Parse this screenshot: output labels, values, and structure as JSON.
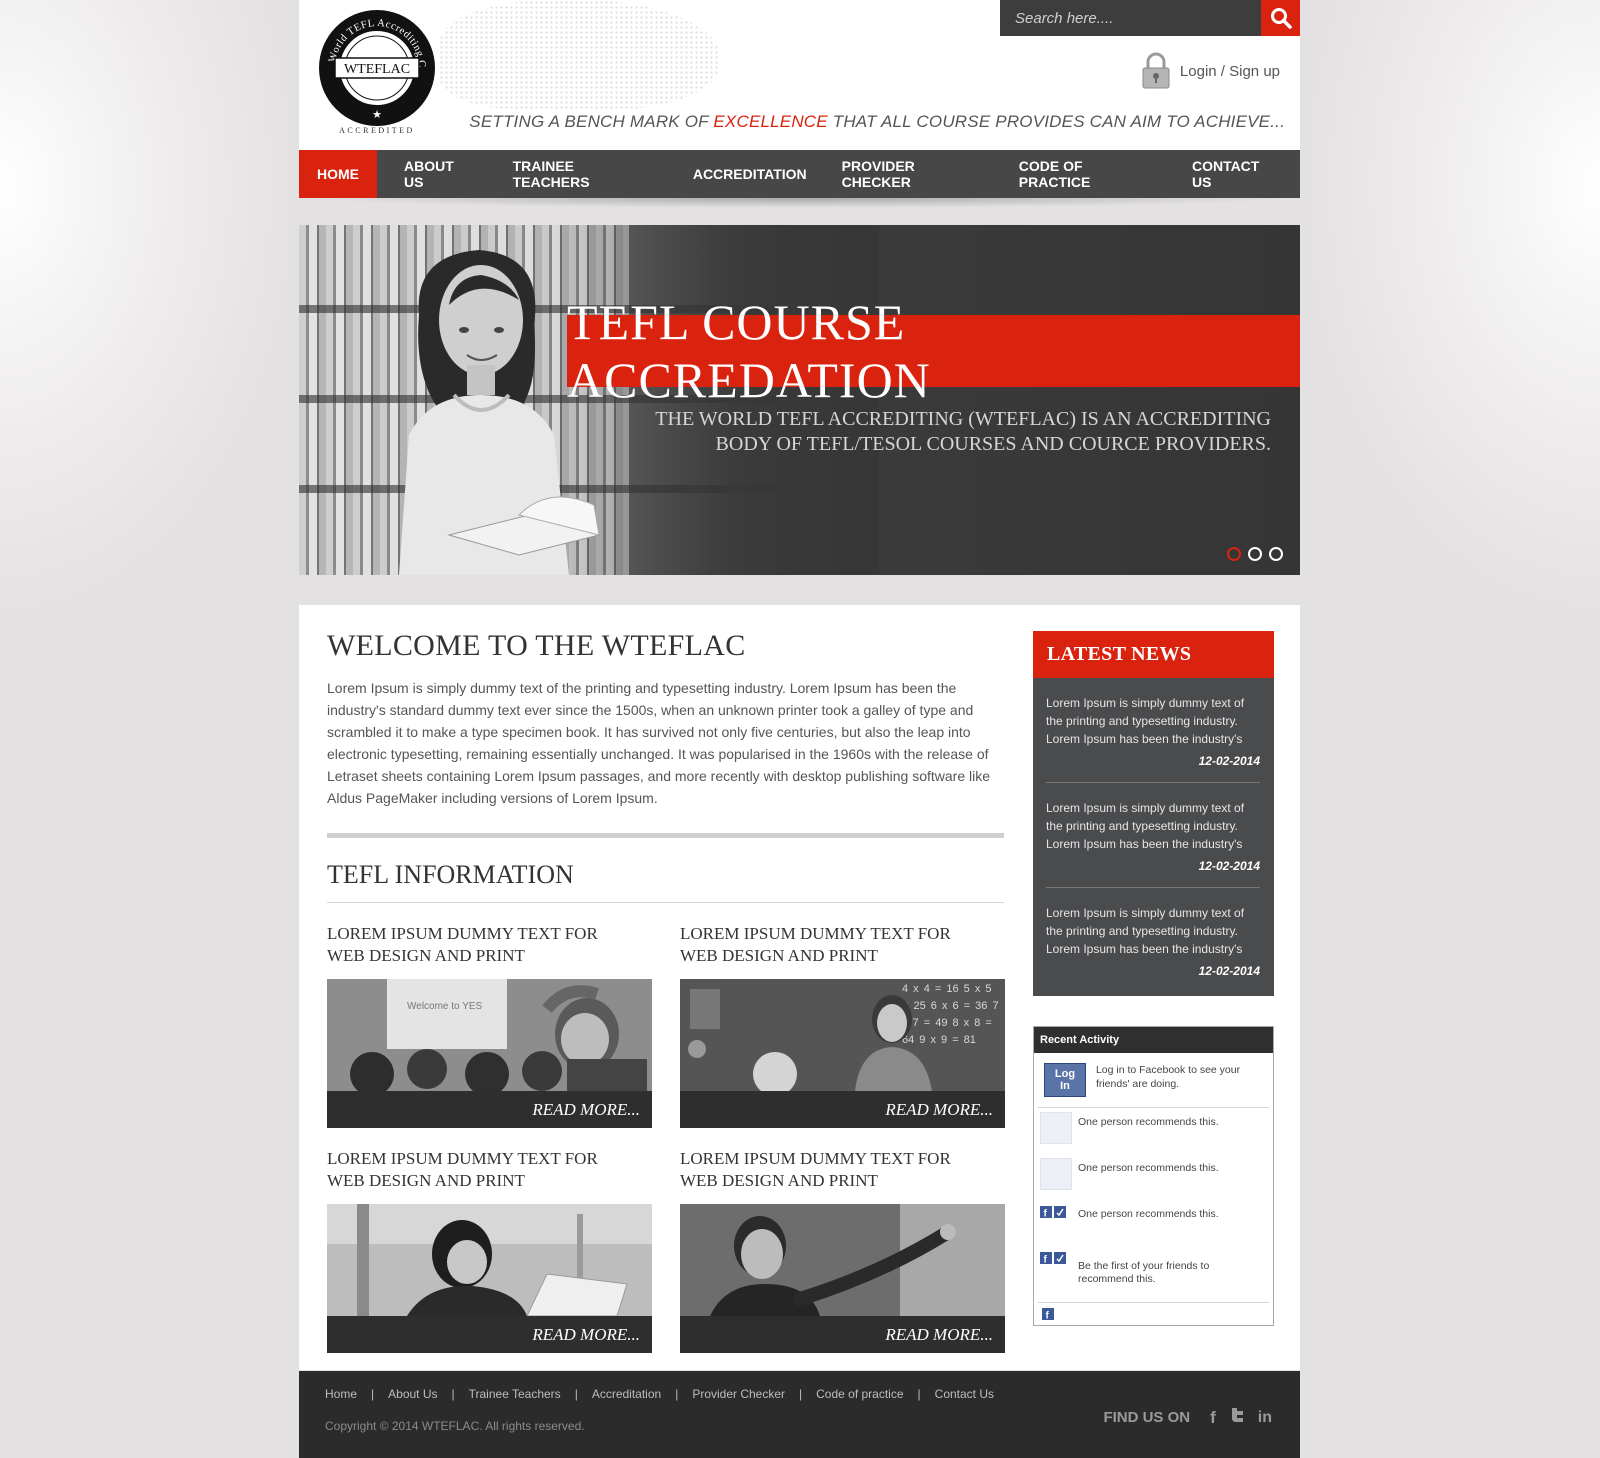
{
  "header": {
    "logo_ring_text": "World TEFL Accrediting Commission",
    "logo_name": "WTEFLAC",
    "logo_sub": "ACCREDITED",
    "search_placeholder": "Search here....",
    "login_label": "Login / Sign up",
    "tagline_pre": "SETTING A BENCH MARK OF ",
    "tagline_highlight": "EXCELLENCE",
    "tagline_post": " THAT ALL COURSE PROVIDES CAN AIM TO ACHIEVE..."
  },
  "nav": {
    "items": [
      {
        "label": "HOME",
        "active": true
      },
      {
        "label": "ABOUT US"
      },
      {
        "label": "TRAINEE TEACHERS"
      },
      {
        "label": "ACCREDITATION"
      },
      {
        "label": "PROVIDER CHECKER"
      },
      {
        "label": "CODE OF PRACTICE"
      },
      {
        "label": "CONTACT US"
      }
    ]
  },
  "hero": {
    "title": "TEFL COURSE ACCREDATION",
    "subtitle_line1": "THE WORLD TEFL ACCREDITING (WTEFLAC) IS AN ACCREDITING",
    "subtitle_line2": "BODY OF TEFL/TESOL COURSES AND COURCE PROVIDERS.",
    "slides": 3,
    "active_slide": 1
  },
  "main": {
    "welcome_title": "WELCOME TO THE WTEFLAC",
    "welcome_text": "Lorem Ipsum is simply dummy text of the printing and typesetting industry. Lorem Ipsum has been the industry's standard dummy text ever since the 1500s, when an unknown printer took a galley of type and scrambled it to make a type specimen book. It has survived not only five centuries, but also the leap into electronic typesetting, remaining essentially unchanged. It was popularised in the 1960s with the release of Letraset sheets containing Lorem Ipsum passages, and more recently with desktop publishing software like Aldus PageMaker including versions of Lorem Ipsum.",
    "info_title": "TEFL INFORMATION",
    "cards": [
      {
        "title_line1": "LOREM IPSUM DUMMY TEXT FOR",
        "title_line2": "WEB DESIGN AND PRINT",
        "read_more": "READ MORE..."
      },
      {
        "title_line1": "LOREM IPSUM DUMMY TEXT FOR",
        "title_line2": "WEB DESIGN AND PRINT",
        "read_more": "READ MORE..."
      },
      {
        "title_line1": "LOREM IPSUM DUMMY TEXT FOR",
        "title_line2": "WEB DESIGN AND PRINT",
        "read_more": "READ MORE..."
      },
      {
        "title_line1": "LOREM IPSUM DUMMY TEXT FOR",
        "title_line2": "WEB DESIGN AND PRINT",
        "read_more": "READ MORE..."
      }
    ],
    "chalkboard_text": "4 x 4 = 16  5 x 5 = 25  6 x 6 = 36  7 x 7 = 49  8 x 8 = 64  9 x 9 = 81",
    "classroom_board_text": "Welcome to  YES"
  },
  "news": {
    "title": "LATEST NEWS",
    "items": [
      {
        "text": "Lorem Ipsum is simply dummy text of the printing and typesetting industry. Lorem Ipsum has been the industry's",
        "date": "12-02-2014"
      },
      {
        "text": "Lorem Ipsum is simply dummy text of the printing and typesetting industry. Lorem Ipsum has been the industry's",
        "date": "12-02-2014"
      },
      {
        "text": "Lorem Ipsum is simply dummy text of the printing and typesetting industry. Lorem Ipsum has been the industry's",
        "date": "12-02-2014"
      }
    ]
  },
  "facebook": {
    "title": "Recent Activity",
    "login_button": "Log In",
    "login_text": "Log in to Facebook to see your friends' are doing.",
    "rows": [
      "One person recommends this.",
      "One person recommends this.",
      "One person recommends this.",
      "Be the first of your friends to recommend this."
    ]
  },
  "footer": {
    "links": [
      "Home",
      "About Us",
      "Trainee Teachers",
      "Accreditation",
      "Provider Checker",
      "Code of practice",
      "Contact Us"
    ],
    "copyright": "Copyright © 2014 WTEFLAC. All rights reserved.",
    "find_us": "FIND US ON",
    "social": [
      "facebook-icon",
      "twitter-icon",
      "linkedin-icon"
    ]
  },
  "colors": {
    "accent": "#d9230f",
    "nav_bg": "#474747",
    "news_bg": "#4a4b4d",
    "footer_bg": "#2b2b2b"
  }
}
